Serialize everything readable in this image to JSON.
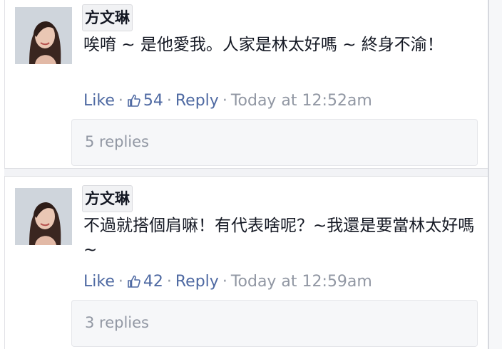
{
  "comments": [
    {
      "author": "方文琳",
      "text": "唉唷 ~ 是他愛我。人家是林太好嗎 ~ 終身不渝！",
      "like_label": "Like",
      "like_count": "54",
      "reply_label": "Reply",
      "timestamp": "Today at 12:52am",
      "replies_label": "5 replies"
    },
    {
      "author": "方文琳",
      "text": "不過就搭個肩嘛！有代表啥呢？~我還是要當林太好嗎 ~",
      "like_label": "Like",
      "like_count": "42",
      "reply_label": "Reply",
      "timestamp": "Today at 12:59am",
      "replies_label": "3 replies"
    }
  ],
  "separator_glyph": "·",
  "colors": {
    "link": "#4e69a2",
    "meta_gray": "#9197a3",
    "text": "#141823",
    "panel_bg": "#f6f7f9"
  },
  "icons": {
    "like_count": "thumbs-up-icon"
  }
}
